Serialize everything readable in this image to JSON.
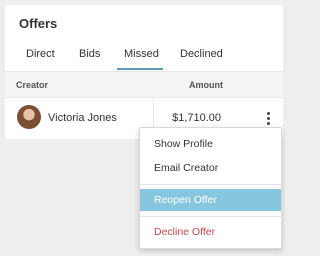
{
  "panel": {
    "title": "Offers",
    "tabs": [
      {
        "label": "Direct",
        "active": false
      },
      {
        "label": "Bids",
        "active": false
      },
      {
        "label": "Missed",
        "active": true
      },
      {
        "label": "Declined",
        "active": false
      }
    ],
    "columns": {
      "creator": "Creator",
      "amount": "Amount"
    },
    "rows": [
      {
        "creator": "Victoria Jones",
        "amount": "$1,710.00"
      }
    ]
  },
  "menu": {
    "items": [
      {
        "label": "Show Profile",
        "highlighted": false
      },
      {
        "label": "Email Creator",
        "highlighted": false
      },
      {
        "label": "Reopen Offer",
        "highlighted": true
      },
      {
        "label": "Decline Offer",
        "highlighted": false,
        "danger": true
      }
    ]
  },
  "colors": {
    "accent": "#5b9db5",
    "highlight_bg": "#86c6de",
    "danger": "#c44a54",
    "page_bg": "#eeeeee"
  },
  "icons": {
    "row_menu": "more-vertical-icon"
  }
}
